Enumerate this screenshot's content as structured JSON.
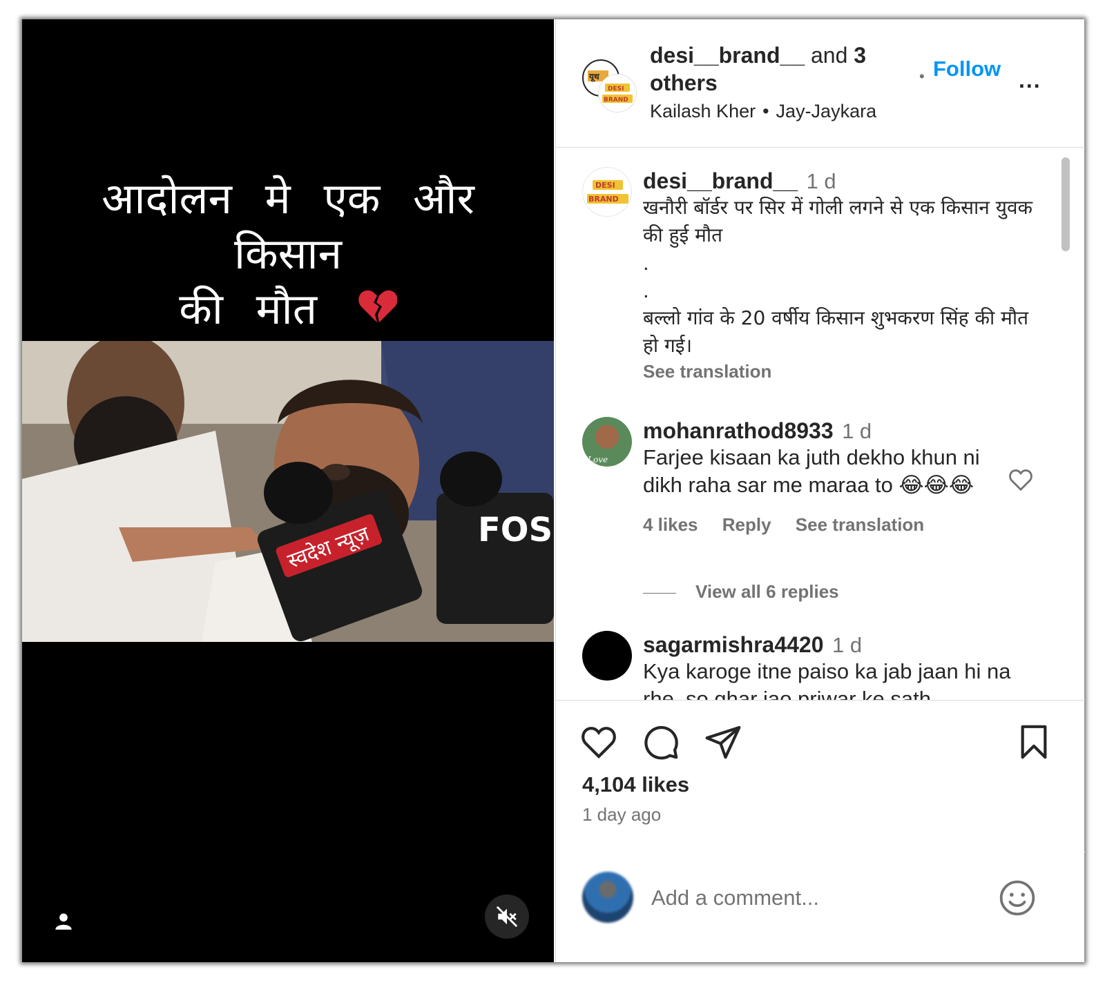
{
  "media": {
    "overlay_line1": "आदोलन मे एक और किसान",
    "overlay_line2": "की मौत",
    "overlay_emoji": "💔",
    "mic_labels": [
      "स्वदेश न्यूज़",
      "FOS"
    ]
  },
  "header": {
    "user": "desi__brand__",
    "and_text": " and ",
    "others": "3 others",
    "artist": "Kailash Kher",
    "song": "Jay-Jaykara",
    "follow_label": "Follow",
    "more_label": "...",
    "avatar_text_top": "DESI",
    "avatar_text_bottom": "BRAND",
    "avatar_behind_text": "यूथ"
  },
  "caption": {
    "user": "desi__brand__",
    "time": "1 d",
    "line1": "खनौरी बॉर्डर पर सिर में गोली लगने से एक किसान युवक की हुई मौत",
    "dot1": ".",
    "dot2": ".",
    "line2": "बल्लो गांव के 20 वर्षीय किसान शुभकरण सिंह की मौत हो गई।",
    "see_translation": "See translation",
    "avatar_text_top": "DESI",
    "avatar_text_bottom": "BRAND"
  },
  "comments": [
    {
      "user": "mohanrathod8933",
      "time": "1 d",
      "text": "Farjee kisaan ka juth dekho khun ni dikh raha sar me maraa to 😂😂😂",
      "likes": "4 likes",
      "reply": "Reply",
      "see_translation": "See translation",
      "view_replies": "View all 6 replies",
      "avatar_text": "Love"
    },
    {
      "user": "sagarmishra4420",
      "time": "1 d",
      "text": "Kya karoge itne paiso ka jab jaan hi na rhe .so ghar jao priwar ke sath"
    }
  ],
  "footer": {
    "likes": "4,104 likes",
    "time_ago": "1 day ago",
    "comment_placeholder": "Add a comment..."
  },
  "colors": {
    "accent": "#0095f6",
    "text": "#262626",
    "secondary": "#737373",
    "border": "#dbdbdb"
  },
  "icons": [
    "heart-icon",
    "comment-icon",
    "share-icon",
    "bookmark-icon",
    "emoji-icon",
    "mute-icon",
    "user-tag-icon",
    "more-icon"
  ]
}
